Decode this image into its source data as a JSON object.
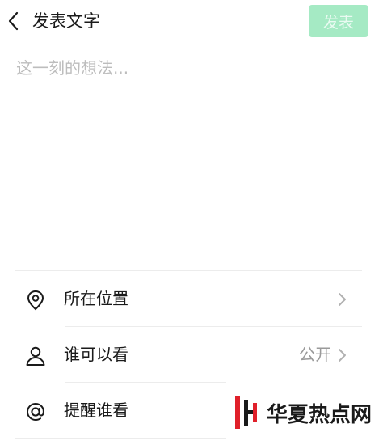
{
  "header": {
    "title": "发表文字",
    "post_label": "发表"
  },
  "composer": {
    "placeholder": "这一刻的想法...",
    "value": ""
  },
  "options": [
    {
      "label": "所在位置",
      "value": ""
    },
    {
      "label": "谁可以看",
      "value": "公开"
    },
    {
      "label": "提醒谁看",
      "value": ""
    }
  ],
  "watermark": {
    "text": "华夏热点网"
  },
  "colors": {
    "accent_disabled": "#a5eac4",
    "accent_disabled_text": "#e9faf1",
    "placeholder": "#bdbdbd",
    "watermark_red": "#e0202a"
  },
  "icons": {
    "back": "chevron-left-icon",
    "location": "location-pin-icon",
    "visibility": "person-icon",
    "mention": "at-sign-icon",
    "chevron": "chevron-right-icon"
  }
}
